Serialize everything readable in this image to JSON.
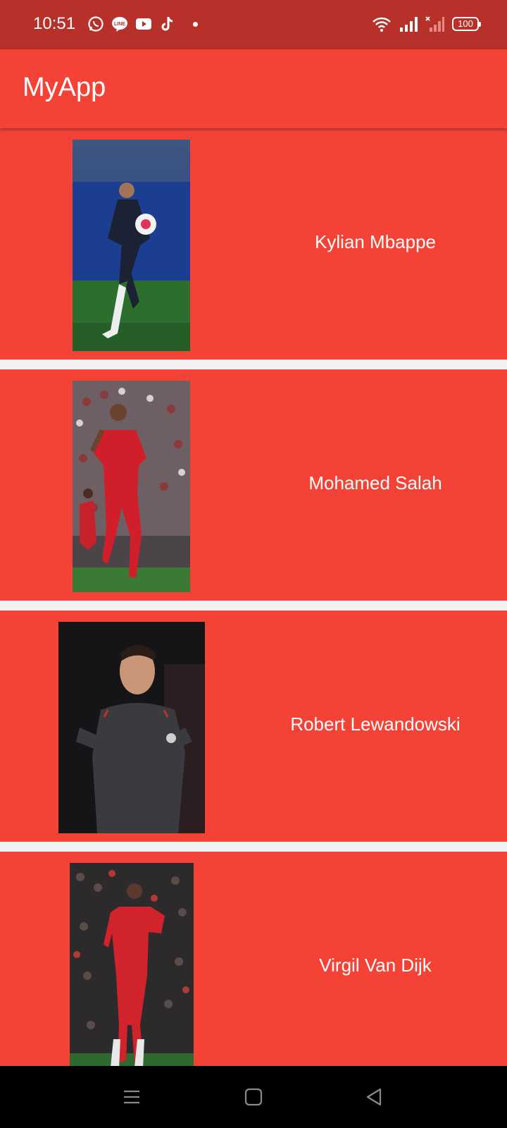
{
  "status_bar": {
    "time": "10:51",
    "battery": "100",
    "left_icons": [
      "whatsapp-icon",
      "line-icon",
      "youtube-icon",
      "tiktok-icon",
      "notification-dot-icon"
    ],
    "right_icons": [
      "wifi-icon",
      "signal-icon",
      "signal-x-icon",
      "battery-icon"
    ]
  },
  "app_bar": {
    "title": "MyApp"
  },
  "players": [
    {
      "name": "Kylian Mbappe"
    },
    {
      "name": "Mohamed Salah"
    },
    {
      "name": "Robert Lewandowski"
    },
    {
      "name": "Virgil Van Dijk"
    }
  ],
  "nav_bar": {
    "buttons": [
      "menu-icon",
      "home-icon",
      "back-icon"
    ]
  },
  "colors": {
    "status_bar": "#b8302a",
    "app_bar": "#f44336",
    "card": "#f44336",
    "divider": "#f2f2f2",
    "nav_bar": "#000000"
  }
}
